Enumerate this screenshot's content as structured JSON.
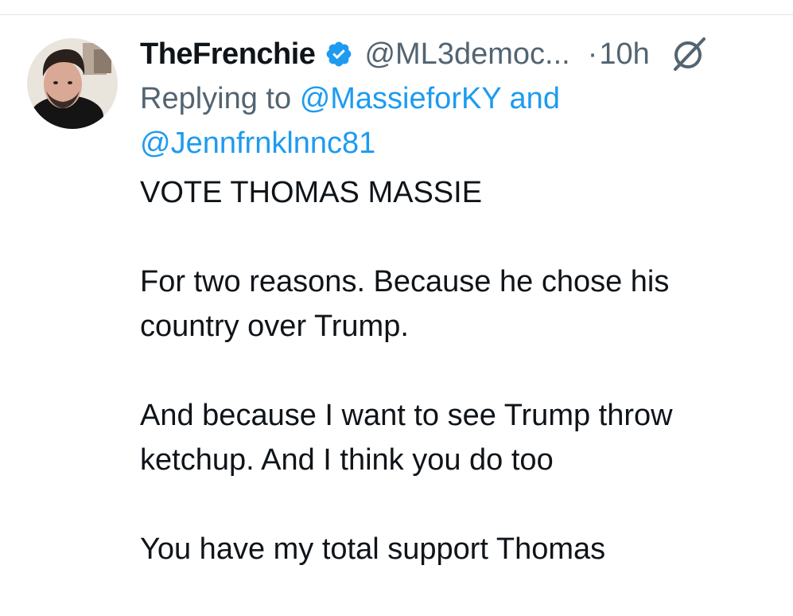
{
  "tweet": {
    "author": {
      "display_name": "TheFrenchie",
      "handle": "@ML3democ...",
      "verified": true,
      "verified_color": "#1d9bf0"
    },
    "separator": "·",
    "time": "10h",
    "reply": {
      "prefix": "Replying to",
      "mention_1": "@MassieforKY",
      "conjunction": "and",
      "mention_2": "@Jennfrnklnnc81"
    },
    "paragraphs": [
      "VOTE THOMAS MASSIE",
      "For two reasons. Because he chose his country over Trump.",
      "And because I want to see Trump throw ketchup. And I think you do too",
      "You have my total support Thomas"
    ]
  },
  "icons": {
    "verified": "verified-badge-icon",
    "grok": "grok-icon"
  },
  "colors": {
    "text_primary": "#0f1419",
    "text_secondary": "#536471",
    "link": "#1d9bf0"
  }
}
